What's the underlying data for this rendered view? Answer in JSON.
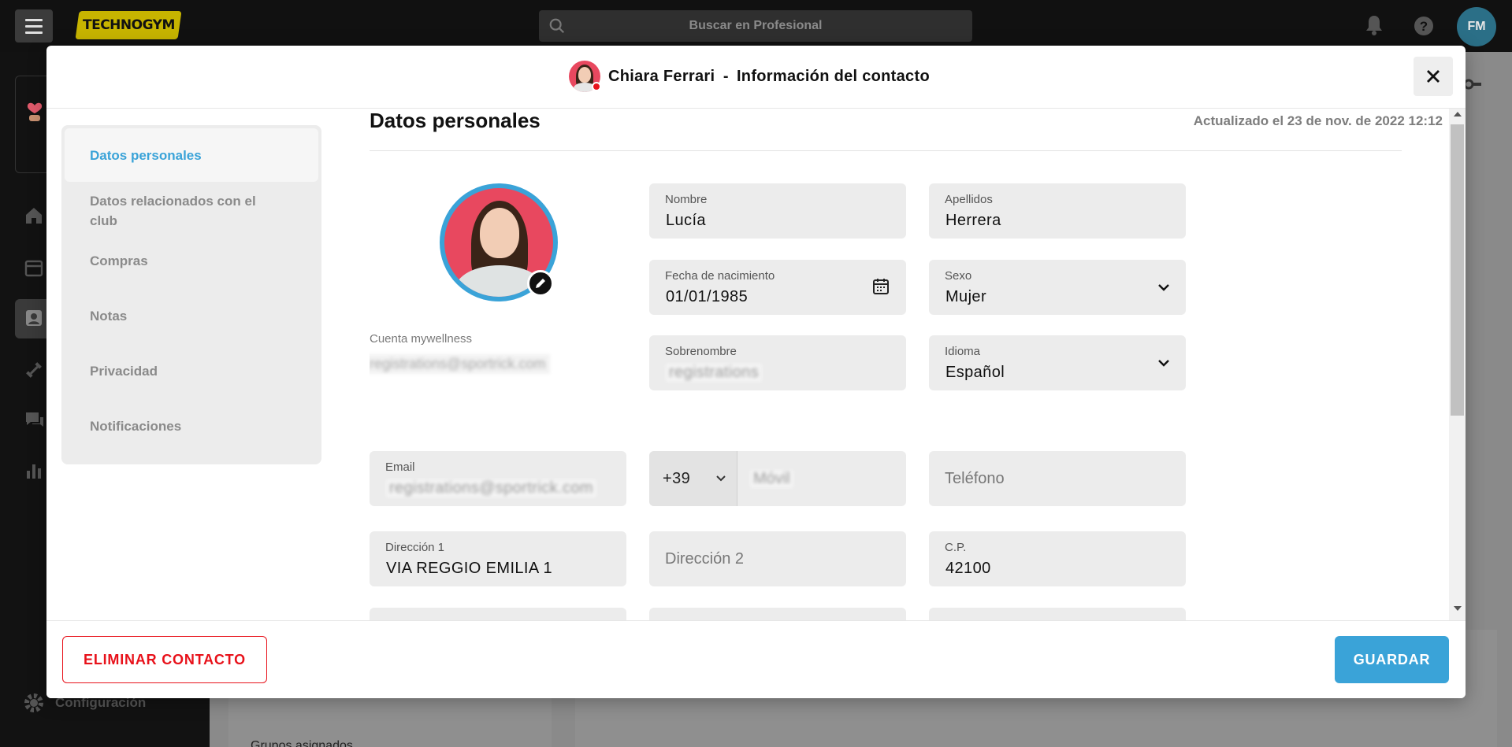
{
  "app": {
    "logo_text": "TECHNOGYM",
    "search_placeholder": "Buscar en Profesional",
    "user_initials": "FM",
    "config_label": "Configuración",
    "bottom_panel_text": "Grupos asignados"
  },
  "modal": {
    "contact_name": "Chiara Ferrari",
    "separator": "-",
    "title": "Información del contacto",
    "nav": [
      {
        "label": "Datos personales",
        "active": true
      },
      {
        "label": "Datos relacionados con el club",
        "active": false
      },
      {
        "label": "Compras",
        "active": false
      },
      {
        "label": "Notas",
        "active": false
      },
      {
        "label": "Privacidad",
        "active": false
      },
      {
        "label": "Notificaciones",
        "active": false
      }
    ],
    "section_title": "Datos personales",
    "updated": "Actualizado el 23 de nov. de 2022 12:12",
    "mywellness_label": "Cuenta mywellness",
    "mywellness_value": "registrations@sportrick.com",
    "fields": {
      "nombre": {
        "label": "Nombre",
        "value": "Lucía"
      },
      "apellidos": {
        "label": "Apellidos",
        "value": "Herrera"
      },
      "fecha": {
        "label": "Fecha de nacimiento",
        "value": "01/01/1985"
      },
      "sexo": {
        "label": "Sexo",
        "value": "Mujer"
      },
      "sobrenombre": {
        "label": "Sobrenombre",
        "value": "registrations"
      },
      "idioma": {
        "label": "Idioma",
        "value": "Español"
      },
      "email": {
        "label": "Email",
        "value": "registrations@sportrick.com"
      },
      "prefix": {
        "value": "+39"
      },
      "movil": {
        "placeholder": "Móvil"
      },
      "telefono": {
        "placeholder": "Teléfono"
      },
      "direccion1": {
        "label": "Dirección 1",
        "value": "VIA REGGIO EMILIA 1"
      },
      "direccion2": {
        "placeholder": "Dirección 2"
      },
      "cp": {
        "label": "C.P.",
        "value": "42100"
      }
    },
    "buttons": {
      "delete": "ELIMINAR CONTACTO",
      "save": "GUARDAR"
    }
  },
  "colors": {
    "accent": "#3aa3d8",
    "danger": "#e8121b",
    "logo": "#c7b400"
  }
}
